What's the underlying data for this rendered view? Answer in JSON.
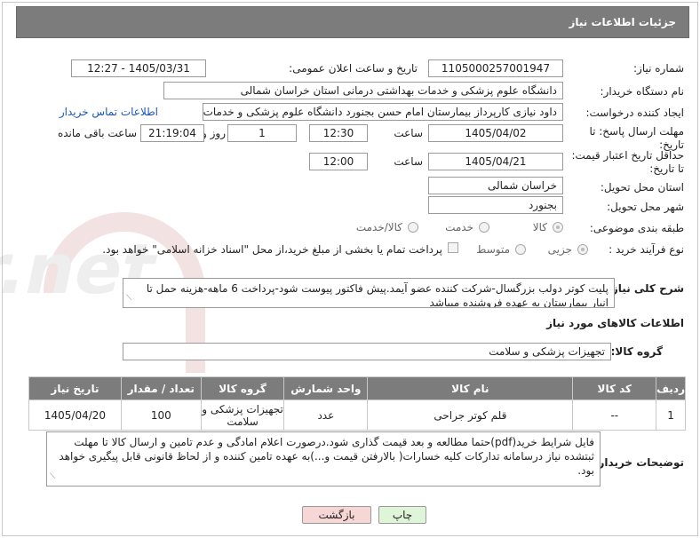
{
  "page": {
    "title": "جزئیات اطلاعات نیاز"
  },
  "form": {
    "need_number_label": "شماره نیاز:",
    "need_number": "1105000257001947",
    "announce_label": "تاریخ و ساعت اعلان عمومی:",
    "announce_value": "1405/03/31 - 12:27",
    "buyer_org_label": "نام دستگاه خریدار:",
    "buyer_org": "دانشگاه علوم پزشکی و خدمات بهداشتی درمانی استان خراسان شمالی",
    "requester_label": "ایجاد کننده درخواست:",
    "requester": "داود نیازی کارپرداز بیمارستان امام حسن بجنورد دانشگاه علوم پزشکی و خدمات",
    "contact_link": "اطلاعات تماس خریدار",
    "deadline_label_1": "مهلت ارسال پاسخ: تا",
    "deadline_label_2": "تاریخ:",
    "deadline_date": "1405/04/02",
    "hour_label": "ساعت",
    "deadline_time": "12:30",
    "days_value": "1",
    "days_label": "روز و",
    "remaining_time": "21:19:04",
    "remaining_label": "ساعت باقی مانده",
    "validity_label_1": "حداقل تاریخ اعتبار قیمت:",
    "validity_label_2": "تا تاریخ:",
    "validity_date": "1405/04/21",
    "validity_time": "12:00",
    "province_label": "استان محل تحویل:",
    "province": "خراسان شمالی",
    "city_label": "شهر محل تحویل:",
    "city": "بجنورد",
    "category_label": "طبقه بندی موضوعی:",
    "category_options": [
      "کالا",
      "خدمت",
      "کالا/خدمت"
    ],
    "process_label": "نوع فرآیند خرید :",
    "process_options": [
      "جزیی",
      "متوسط"
    ],
    "payment_note": "پرداخت تمام یا بخشی از مبلغ خرید،از محل \"اسناد خزانه اسلامی\" خواهد بود."
  },
  "description": {
    "label": "شرح کلی نیاز:",
    "text": "پلیت کوتر دولب بزرگسال-شرکت کننده عضو آیمد.پیش فاکتور پیوست  شود-پرداخت 6 ماهه-هزینه حمل تا انبار بیمارستان به عهده فروشنده میباشد"
  },
  "goods": {
    "section_title": "اطلاعات کالاهای مورد نیاز",
    "group_label": "گروه کالا:",
    "group_value": "تجهیزات پزشکی و سلامت",
    "columns": [
      "ردیف",
      "کد کالا",
      "نام کالا",
      "واحد شمارش",
      "گروه کالا",
      "تعداد / مقدار",
      "تاریخ نیاز"
    ],
    "rows": [
      [
        "1",
        "--",
        "قلم کوتر جراحی",
        "عدد",
        "تجهیزات پزشکی و سلامت",
        "100",
        "1405/04/20"
      ]
    ]
  },
  "buyer_notes": {
    "label": "توضیحات خریدار:",
    "text": "فایل شرایط خرید(pdf)حتما مطالعه و بعد قیمت گذاری شود.درصورت اعلام امادگی و عدم تامین و ارسال کالا تا مهلت ثبتشده نیاز درسامانه تدارکات کلیه خسارات( بالارفتن قیمت و...)به عهده تامین کننده و از لحاظ قانونی قابل پیگیری خواهد بود."
  },
  "buttons": {
    "print": "چاپ",
    "back": "بازگشت"
  },
  "colors": {
    "header_bg": "#7c7c7c",
    "link": "#1a56b8",
    "back_button_bg": "#f7d6d6",
    "print_button_bg": "#dff5d8"
  }
}
